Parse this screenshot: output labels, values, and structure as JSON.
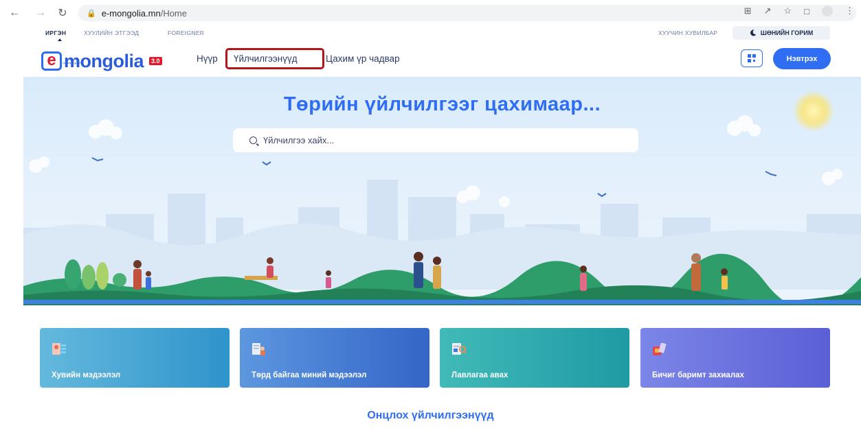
{
  "browser": {
    "url_host": "e-mongolia.mn",
    "url_path": "/Home"
  },
  "top_strip": {
    "tabs": [
      {
        "label": "ИРГЭН",
        "active": true
      },
      {
        "label": "ХУУЛИЙН ЭТГЭЭД",
        "active": false
      },
      {
        "label": "FOREIGNER",
        "active": false
      }
    ],
    "old_version": "ХУУЧИН ХУВИЛБАР",
    "dark_mode": "ШӨНИЙН ГОРИМ"
  },
  "header": {
    "logo_letter": "e",
    "logo_word": "mongolia",
    "logo_version": "3.0",
    "logo_tagline": "Цахим үндэстэн",
    "menu": [
      {
        "label": "Нүүр"
      },
      {
        "label": "Үйлчилгээнүүд",
        "highlighted": true
      },
      {
        "label": "Цахим үр чадвар"
      }
    ],
    "login_label": "Нэвтрэх"
  },
  "hero": {
    "title": "Төрийн үйлчилгээг цахимаар...",
    "search_placeholder": "Үйлчилгээ хайх..."
  },
  "cards": [
    {
      "label": "Хувийн мэдээлэл",
      "icon": "personal-info-icon",
      "color_from": "#5fb6d9",
      "color_to": "#2f8fc9"
    },
    {
      "label": "Төрд байгаа миний мэдээлэл",
      "icon": "my-info-icon",
      "color_from": "#5b95de",
      "color_to": "#3767c9"
    },
    {
      "label": "Лавлагаа авах",
      "icon": "reference-icon",
      "color_from": "#3fb9b7",
      "color_to": "#1f9aa3"
    },
    {
      "label": "Бичиг баримт захиалах",
      "icon": "document-order-icon",
      "color_from": "#7b84e6",
      "color_to": "#5a5ed6"
    }
  ],
  "section_title": "Онцлох үйлчилгээнүүд",
  "colors": {
    "brand_blue": "#2f6ef2",
    "highlight_red": "#b4151b"
  }
}
